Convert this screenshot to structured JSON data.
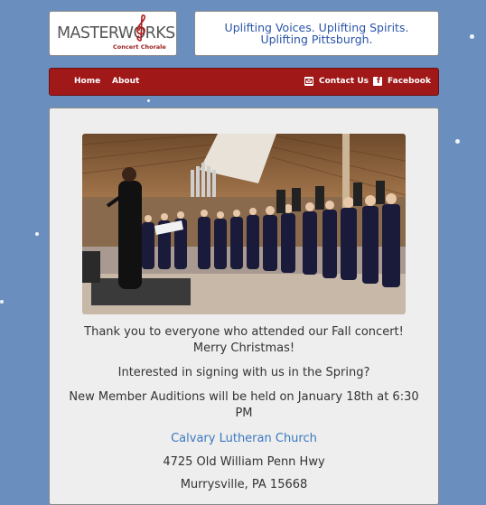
{
  "header": {
    "logo": {
      "main_text": "MASTERWORKS",
      "sub_text": "Concert Chorale"
    },
    "tagline": "Uplifting Voices. Uplifting Spirits. Uplifting Pittsburgh."
  },
  "nav": {
    "home": "Home",
    "about": "About",
    "contact": "Contact Us",
    "facebook": "Facebook"
  },
  "main": {
    "photo_alt": "Choir performing with conductor in church",
    "message": "Thank you to everyone who attended our Fall concert! Merry Christmas!",
    "spring_prompt": "Interested in signing with us in the Spring?",
    "auditions": "New Member Auditions will be held on January 18th at 6:30 PM",
    "venue_link": "Calvary Lutheran Church",
    "address1": "4725 Old William Penn Hwy",
    "address2": "Murrysville, PA 15668"
  },
  "colors": {
    "background": "#6a8fbf",
    "nav": "#a01818",
    "link": "#3a78c0",
    "tagline": "#2a55a8"
  }
}
